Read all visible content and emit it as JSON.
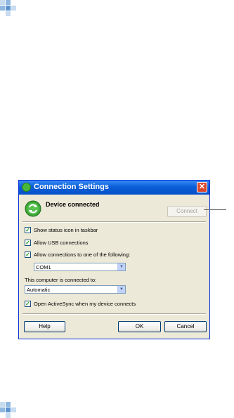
{
  "colors": {
    "accent": "#0a5fd8",
    "decorative_squares": "#8fb8e0",
    "check": "#21a121"
  },
  "dialog": {
    "title": "Connection Settings",
    "close_glyph": "✕",
    "status": "Device connected",
    "connect_button": "Connect",
    "options": [
      {
        "label": "Show status icon in taskbar",
        "checked": true
      },
      {
        "label": "Allow USB connections",
        "checked": true
      },
      {
        "label": "Allow connections to one of the following:",
        "checked": true
      }
    ],
    "port_select": {
      "value": "COM1",
      "arrow": "▼"
    },
    "computer_connected_label": "This computer is connected to:",
    "network_select": {
      "value": "Automatic",
      "arrow": "▼"
    },
    "activesync_option": {
      "label": "Open ActiveSync when my device connects",
      "checked": true
    },
    "help_button": "Help",
    "ok_button": "OK",
    "cancel_button": "Cancel",
    "check_glyph": "✓"
  }
}
